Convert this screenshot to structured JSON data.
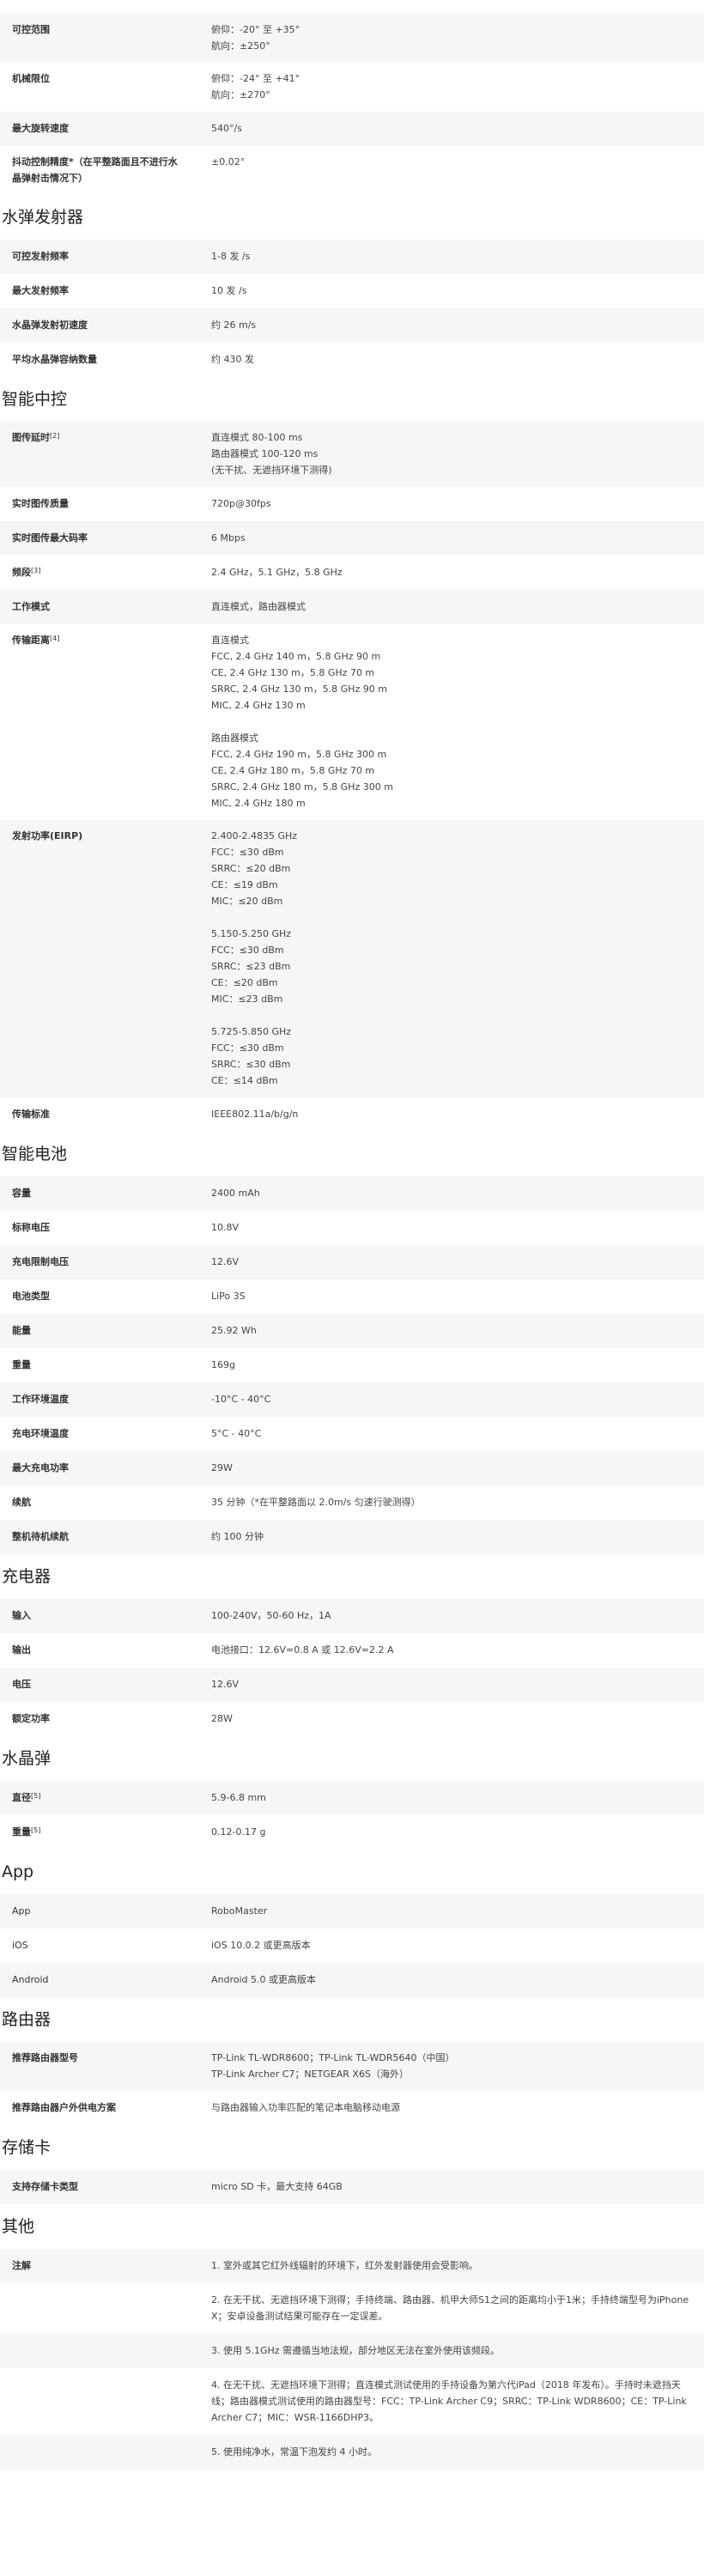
{
  "sections": [
    {
      "title": "",
      "rows": [
        {
          "label": "可控范围",
          "values": [
            "俯仰：-20° 至 +35°",
            "航向：±250°"
          ]
        },
        {
          "label": "机械限位",
          "values": [
            "俯仰：-24° 至 +41°",
            "航向：±270°"
          ]
        },
        {
          "label": "最大旋转速度",
          "values": [
            "540°/s"
          ]
        },
        {
          "label": "抖动控制精度*（在平整路面且不进行水晶弹射击情况下）",
          "values": [
            "±0.02°"
          ]
        }
      ]
    },
    {
      "title": "水弹发射器",
      "rows": [
        {
          "label": "可控发射频率",
          "values": [
            "1-8 发 /s"
          ]
        },
        {
          "label": "最大发射频率",
          "values": [
            "10 发 /s"
          ]
        },
        {
          "label": "水晶弹发射初速度",
          "values": [
            "约 26 m/s"
          ]
        },
        {
          "label": "平均水晶弹容纳数量",
          "values": [
            "约 430 发"
          ]
        }
      ]
    },
    {
      "title": "智能中控",
      "rows": [
        {
          "label": "图传延时",
          "sup": "[2]",
          "values": [
            "直连模式 80-100 ms",
            "路由器模式 100-120 ms",
            "(无干扰、无遮挡环境下测得)"
          ]
        },
        {
          "label": "实时图传质量",
          "values": [
            "720p@30fps"
          ]
        },
        {
          "label": "实时图传最大码率",
          "values": [
            "6 Mbps"
          ]
        },
        {
          "label": "频段",
          "sup": "[3]",
          "values": [
            "2.4 GHz，5.1 GHz，5.8 GHz"
          ]
        },
        {
          "label": "工作模式",
          "values": [
            "直连模式，路由器模式"
          ]
        },
        {
          "label": "传输距离",
          "sup": "[4]",
          "values": [
            "直连模式",
            "FCC, 2.4 GHz 140 m，5.8 GHz 90 m",
            "CE, 2.4 GHz 130 m，5.8 GHz 70 m",
            "SRRC, 2.4 GHz 130 m，5.8 GHz 90 m",
            "MIC, 2.4 GHz 130 m",
            "",
            "路由器模式",
            "FCC, 2.4 GHz 190 m，5.8 GHz 300 m",
            "CE, 2.4 GHz 180 m，5.8 GHz 70 m",
            "SRRC, 2.4 GHz 180 m，5.8 GHz 300 m",
            "MIC, 2.4 GHz 180 m"
          ]
        },
        {
          "label": "发射功率(EIRP)",
          "values": [
            "2.400-2.4835 GHz",
            "FCC：≤30 dBm",
            "SRRC：≤20 dBm",
            "CE：≤19 dBm",
            "MIC：≤20 dBm",
            "",
            "5.150-5.250 GHz",
            "FCC：≤30 dBm",
            "SRRC：≤23 dBm",
            "CE：≤20 dBm",
            "MIC：≤23 dBm",
            "",
            "5.725-5.850 GHz",
            "FCC：≤30 dBm",
            "SRRC：≤30 dBm",
            "CE：≤14 dBm"
          ]
        },
        {
          "label": "传输标准",
          "values": [
            "IEEE802.11a/b/g/n"
          ]
        }
      ]
    },
    {
      "title": "智能电池",
      "rows": [
        {
          "label": "容量",
          "values": [
            "2400 mAh"
          ]
        },
        {
          "label": "标称电压",
          "values": [
            "10.8V"
          ]
        },
        {
          "label": "充电限制电压",
          "values": [
            "12.6V"
          ]
        },
        {
          "label": "电池类型",
          "values": [
            "LiPo 3S"
          ]
        },
        {
          "label": "能量",
          "values": [
            "25.92 Wh"
          ]
        },
        {
          "label": "重量",
          "values": [
            "169g"
          ]
        },
        {
          "label": "工作环境温度",
          "values": [
            "-10°C - 40°C"
          ]
        },
        {
          "label": "充电环境温度",
          "values": [
            "5°C - 40°C"
          ]
        },
        {
          "label": "最大充电功率",
          "values": [
            "29W"
          ]
        },
        {
          "label": "续航",
          "values": [
            "35 分钟（*在平整路面以 2.0m/s 匀速行驶测得）"
          ]
        },
        {
          "label": "整机待机续航",
          "values": [
            "约 100 分钟"
          ]
        }
      ]
    },
    {
      "title": "充电器",
      "rows": [
        {
          "label": "输入",
          "values": [
            "100-240V，50-60 Hz，1A"
          ]
        },
        {
          "label": "输出",
          "values": [
            "电池接口：12.6V=0.8 A 或 12.6V=2.2 A"
          ]
        },
        {
          "label": "电压",
          "values": [
            "12.6V"
          ]
        },
        {
          "label": "额定功率",
          "values": [
            "28W"
          ]
        }
      ]
    },
    {
      "title": "水晶弹",
      "rows": [
        {
          "label": "直径",
          "sup": "[5]",
          "values": [
            "5.9-6.8 mm"
          ]
        },
        {
          "label": "重量",
          "sup": "[5]",
          "values": [
            "0.12-0.17 g"
          ]
        }
      ]
    },
    {
      "title": "App",
      "rows": [
        {
          "label": "App",
          "plain": true,
          "values": [
            "RoboMaster"
          ]
        },
        {
          "label": "iOS",
          "plain": true,
          "values": [
            "iOS 10.0.2 或更高版本"
          ]
        },
        {
          "label": "Android",
          "plain": true,
          "values": [
            "Android 5.0 或更高版本"
          ]
        }
      ]
    },
    {
      "title": "路由器",
      "rows": [
        {
          "label": "推荐路由器型号",
          "values": [
            "TP-Link TL-WDR8600；TP-Link TL-WDR5640（中国）",
            "TP-Link Archer C7；NETGEAR X6S（海外）"
          ]
        },
        {
          "label": "推荐路由器户外供电方案",
          "values": [
            "与路由器输入功率匹配的笔记本电脑移动电源"
          ]
        }
      ]
    },
    {
      "title": "存储卡",
      "rows": [
        {
          "label": "支持存储卡类型",
          "values": [
            "micro SD 卡，最大支持 64GB"
          ]
        }
      ]
    },
    {
      "title": "其他",
      "rows": [
        {
          "label": "注解",
          "values": [
            "1. 室外或其它红外线辐射的环境下，红外发射器使用会受影响。"
          ]
        },
        {
          "label": "",
          "values": [
            "2. 在无干扰、无遮挡环境下测得；手持终端、路由器、机甲大师S1之间的距离均小于1米；手持终端型号为iPhone X；安卓设备测试结果可能存在一定误差。"
          ]
        },
        {
          "label": "",
          "values": [
            "3. 使用 5.1GHz 需遵循当地法规，部分地区无法在室外使用该频段。"
          ]
        },
        {
          "label": "",
          "values": [
            "4. 在无干扰、无遮挡环境下测得；直连模式测试使用的手持设备为第六代iPad（2018 年发布）。手持时未遮挡天线；路由器模式测试使用的路由器型号：FCC：TP-Link Archer C9；SRRC：TP-Link WDR8600；CE：TP-Link Archer C7；MIC：WSR-1166DHP3。"
          ]
        },
        {
          "label": "",
          "values": [
            "5. 使用纯净水，常温下泡发约 4 小时。"
          ]
        }
      ]
    }
  ]
}
